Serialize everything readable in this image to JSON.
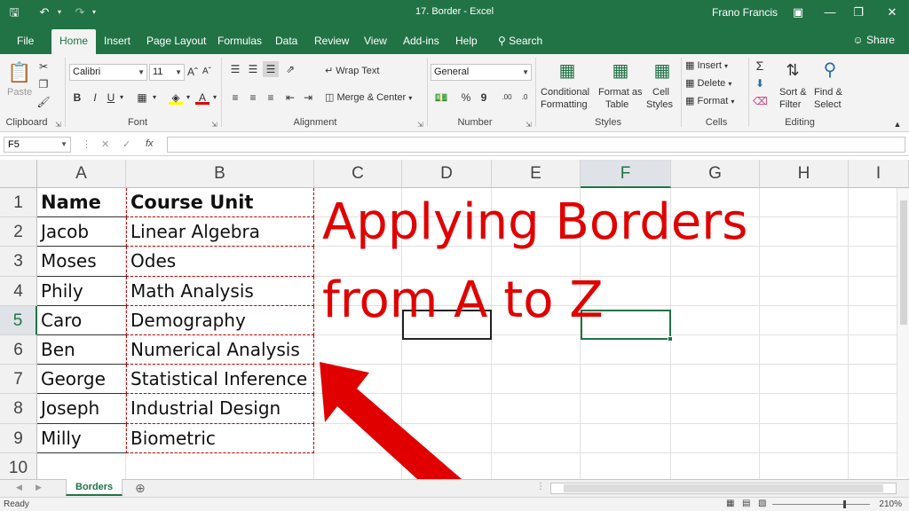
{
  "window": {
    "doc_title": "17. Border  -  Excel",
    "user": "Frano Francis"
  },
  "ribbon_tabs": [
    "File",
    "Home",
    "Insert",
    "Page Layout",
    "Formulas",
    "Data",
    "Review",
    "View",
    "Add-ins",
    "Help",
    "Search"
  ],
  "share_label": "Share",
  "ribbon": {
    "clipboard": {
      "paste": "Paste",
      "label": "Clipboard"
    },
    "font": {
      "family": "Calibri",
      "size": "11",
      "label": "Font",
      "bold": "B",
      "italic": "I",
      "underline": "U",
      "font_color": "A"
    },
    "alignment": {
      "wrap": "Wrap Text",
      "merge": "Merge & Center",
      "label": "Alignment"
    },
    "number": {
      "format": "General",
      "label": "Number",
      "percent": "%",
      "comma": "9",
      "inc_dec": ".00",
      "dec_dec": ".0"
    },
    "styles": {
      "conditional": [
        "Conditional",
        "Formatting"
      ],
      "format_table": [
        "Format as",
        "Table"
      ],
      "cell_styles": [
        "Cell",
        "Styles"
      ],
      "label": "Styles"
    },
    "cells": {
      "insert": "Insert",
      "delete": "Delete",
      "format": "Format",
      "label": "Cells"
    },
    "editing": {
      "sort": [
        "Sort &",
        "Filter"
      ],
      "find": [
        "Find &",
        "Select"
      ],
      "label": "Editing"
    }
  },
  "formula_bar": {
    "name_box": "F5",
    "fx": "fx"
  },
  "columns": [
    "A",
    "B",
    "C",
    "D",
    "E",
    "F",
    "G",
    "H",
    "I"
  ],
  "selected_column": "F",
  "rows": [
    "1",
    "2",
    "3",
    "4",
    "5",
    "6",
    "7",
    "8",
    "9",
    "10"
  ],
  "selected_row": "5",
  "table": {
    "headers": [
      "Name",
      "Course Unit"
    ],
    "rows": [
      [
        "Jacob",
        "Linear Algebra"
      ],
      [
        "Moses",
        "Odes"
      ],
      [
        "Phily",
        "Math Analysis"
      ],
      [
        "Caro",
        "Demography"
      ],
      [
        "Ben",
        "Numerical Analysis"
      ],
      [
        "George",
        "Statistical Inference"
      ],
      [
        "Joseph",
        "Industrial Design"
      ],
      [
        "Milly",
        "Biometric"
      ]
    ]
  },
  "overlay": {
    "line1": "Applying Borders",
    "line2": "from A to Z",
    "color": "#e00000"
  },
  "sheet_tab": "Borders",
  "status": {
    "text": "Ready",
    "zoom": "210%"
  }
}
